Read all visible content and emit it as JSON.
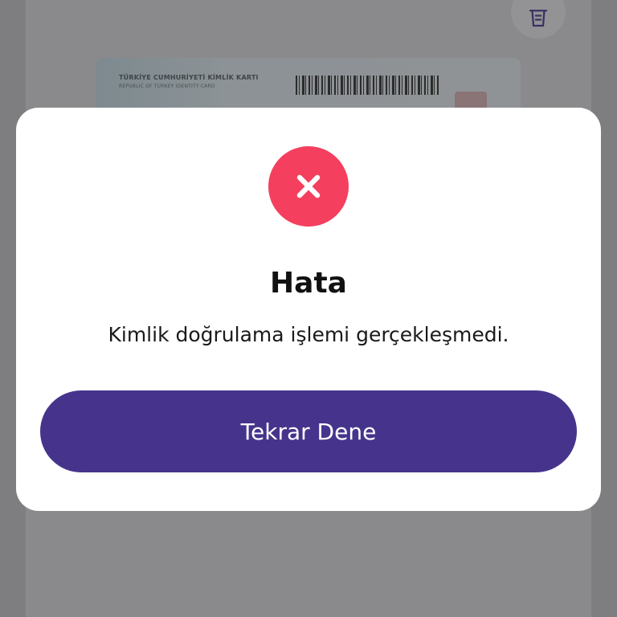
{
  "background": {
    "trash_icon": "trash-icon",
    "id_card": {
      "title": "TÜRKİYE CUMHURİYETİ KİMLİK KARTI",
      "subtitle": "REPUBLIC OF TURKEY IDENTITY CARD"
    }
  },
  "dialog": {
    "status_icon": "close-icon",
    "status_color": "#f43f5e",
    "title": "Hata",
    "message": "Kimlik doğrulama işlemi gerçekleşmedi.",
    "retry_label": "Tekrar Dene",
    "button_color": "#46348c"
  }
}
